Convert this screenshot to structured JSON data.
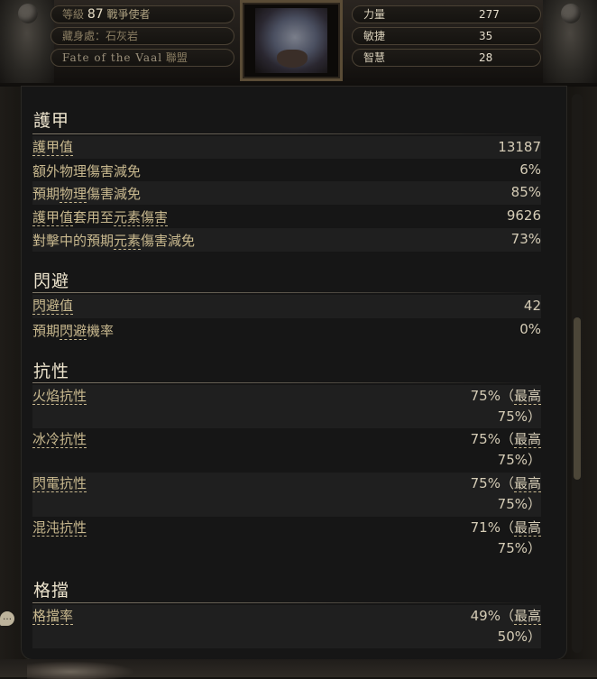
{
  "header": {
    "level_label": "等級",
    "level": "87",
    "class_name": "戰爭使者",
    "hideout": "藏身處：石灰岩",
    "league_name": "Fate of the Vaal",
    "league_suffix": "聯盟",
    "attributes": [
      {
        "label": "力量",
        "value": "277"
      },
      {
        "label": "敏捷",
        "value": "35"
      },
      {
        "label": "智慧",
        "value": "28"
      }
    ]
  },
  "armour": {
    "title": "護甲",
    "rows": [
      {
        "label": "護甲值",
        "value": "13187"
      },
      {
        "label": "額外物理傷害減免",
        "value": "6%"
      },
      {
        "label": "預期物理傷害減免",
        "value": "85%"
      },
      {
        "label": "護甲值套用至元素傷害",
        "value": "9626"
      },
      {
        "label": "對擊中的預期元素傷害減免",
        "value": "73%"
      }
    ]
  },
  "evasion": {
    "title": "閃避",
    "rows": [
      {
        "label": "閃避值",
        "value": "42"
      },
      {
        "label": "預期閃避機率",
        "value": "0%"
      }
    ]
  },
  "resistances": {
    "title": "抗性",
    "rows": [
      {
        "label": "火焰抗性",
        "value": "75%",
        "max_prefix": "（",
        "max_label": "最高",
        "max_value": "75%）"
      },
      {
        "label": "冰冷抗性",
        "value": "75%",
        "max_prefix": "（",
        "max_label": "最高",
        "max_value": "75%）"
      },
      {
        "label": "閃電抗性",
        "value": "75%",
        "max_prefix": "（",
        "max_label": "最高",
        "max_value": "75%）"
      },
      {
        "label": "混沌抗性",
        "value": "71%",
        "max_prefix": "（",
        "max_label": "最高",
        "max_value": "75%）"
      }
    ]
  },
  "block": {
    "title": "格擋",
    "rows": [
      {
        "label": "格擋率",
        "value": "49%",
        "max_prefix": "（",
        "max_label": "最高",
        "max_value": "50%）"
      }
    ]
  }
}
